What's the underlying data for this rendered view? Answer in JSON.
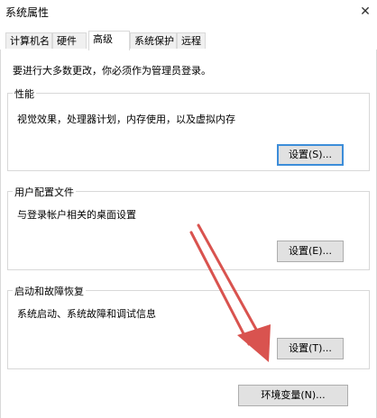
{
  "window": {
    "title": "系统属性",
    "close_glyph": "✕"
  },
  "tabs": [
    {
      "label": "计算机名",
      "active": false
    },
    {
      "label": "硬件",
      "active": false
    },
    {
      "label": "高级",
      "active": true
    },
    {
      "label": "系统保护",
      "active": false
    },
    {
      "label": "远程",
      "active": false
    }
  ],
  "notice": "要进行大多数更改，你必须作为管理员登录。",
  "performance": {
    "legend": "性能",
    "description": "视觉效果，处理器计划，内存使用，以及虚拟内存",
    "button": "设置(S)..."
  },
  "user_profiles": {
    "legend": "用户配置文件",
    "description": "与登录帐户相关的桌面设置",
    "button": "设置(E)..."
  },
  "startup_recovery": {
    "legend": "启动和故障恢复",
    "description": "系统启动、系统故障和调试信息",
    "button": "设置(T)..."
  },
  "env_button": "环境变量(N)...",
  "colors": {
    "arrow": "#d9534f",
    "focus": "#3c8dd9"
  }
}
